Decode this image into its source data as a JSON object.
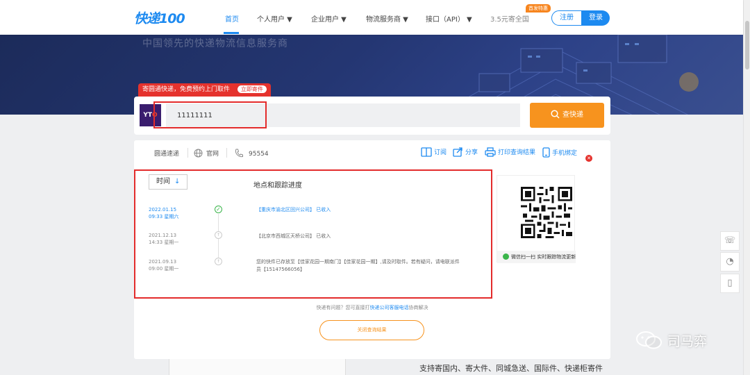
{
  "nav": {
    "logo": "快递100",
    "items": [
      {
        "label": "首页",
        "active": true
      },
      {
        "label": "个人用户 ▼"
      },
      {
        "label": "企业用户 ▼"
      },
      {
        "label": "物流服务商 ▼"
      },
      {
        "label": "接口（API） ▼"
      },
      {
        "label": "3.5元寄全国"
      }
    ],
    "new_tag": "首发特惠",
    "register": "注册",
    "login": "登录"
  },
  "hero": {
    "slogan": "中国领先的快递物流信息服务商"
  },
  "promo": {
    "text": "寄圆通快递，免费预约上门取件",
    "link": "立即寄件"
  },
  "search": {
    "carrier_logo": "YTO",
    "value": "11111111",
    "button": "查快递"
  },
  "result": {
    "carrier": "圆通速递",
    "website": "官网",
    "phone": "95554",
    "actions": {
      "subscribe": "订阅",
      "share": "分享",
      "print": "打印查询结果",
      "mobile": "手机绑定"
    },
    "sort_label": "时间",
    "sort_arrow": "↓",
    "track_header": "地点和跟踪进度",
    "events": [
      {
        "date": "2022.01.15",
        "time": "09:33 星期六",
        "text": "【重庆市渝北区回兴公司】 已收入",
        "done": true
      },
      {
        "date": "2021.12.13",
        "time": "14:33 星期一",
        "text": "【北京市西城区天桥公司】 已收入",
        "done": false
      },
      {
        "date": "2021.09.13",
        "time": "09:00 星期一",
        "text": "您的快件已存放至【佳家花园一期南门】【佳家花园一期】,请及时取件。若有疑问，请电联派件员【15147566056】",
        "done": false
      }
    ],
    "qr_caption": "微信扫一扫 实时跟踪物流更新",
    "help_prefix": "快递有问题？您可直接打",
    "help_link": "快递公司客服电话",
    "help_suffix": "协商解决",
    "close_button": "关闭查询结果"
  },
  "bottom_desc": "支持寄国内、寄大件、同城急送、国际件、快递柜寄件",
  "watermark": "司马弈",
  "side_tools": [
    "headset-icon",
    "qq-icon",
    "mobile-icon"
  ],
  "colors": {
    "brand": "#1d8af0",
    "accent": "#f7931e",
    "highlight": "#e32b2b",
    "done": "#3ab54a"
  }
}
